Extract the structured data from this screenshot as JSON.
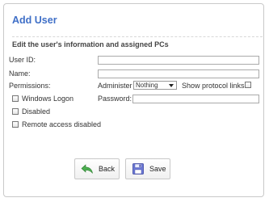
{
  "header": {
    "title": "Add User",
    "subtitle": "Edit the user's information and assigned PCs"
  },
  "form": {
    "user_id_label": "User ID:",
    "user_id_value": "",
    "name_label": "Name:",
    "name_value": "",
    "permissions_label": "Permissions:",
    "administer_label": "Administer",
    "administer_selected": "Nothing",
    "show_protocol_links_label": "Show protocol links",
    "windows_logon_label": "Windows Logon",
    "password_label": "Password:",
    "password_value": "",
    "disabled_label": "Disabled",
    "remote_access_disabled_label": "Remote access disabled"
  },
  "buttons": {
    "back_label": "Back",
    "save_label": "Save"
  },
  "icons": {
    "back": "back-arrow-icon",
    "save": "floppy-disk-icon"
  },
  "colors": {
    "title": "#3f6fc7",
    "back_icon": "#4caf50",
    "save_icon": "#6b78d6"
  }
}
